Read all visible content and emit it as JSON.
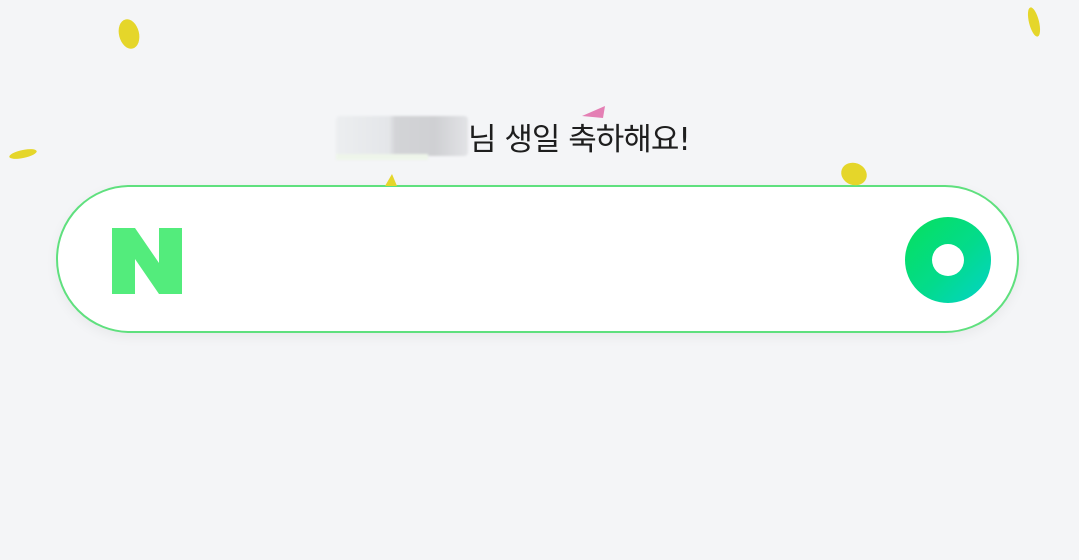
{
  "greeting": {
    "name_redacted": true,
    "message": "님 생일 축하해요!"
  },
  "search_bar": {
    "value": "",
    "logo_icon": "naver-n-logo-icon",
    "button_icon": "green-search-circle-icon"
  },
  "colors": {
    "background": "#f4f5f7",
    "accent_green": "#03db8c",
    "logo_green": "#53ec7c",
    "border_green": "#5fe07e",
    "confetti_yellow": "#e5d62a",
    "confetti_pink": "#e47fb4"
  },
  "decorations": {
    "confetti_icon": "birthday-confetti-icon"
  }
}
